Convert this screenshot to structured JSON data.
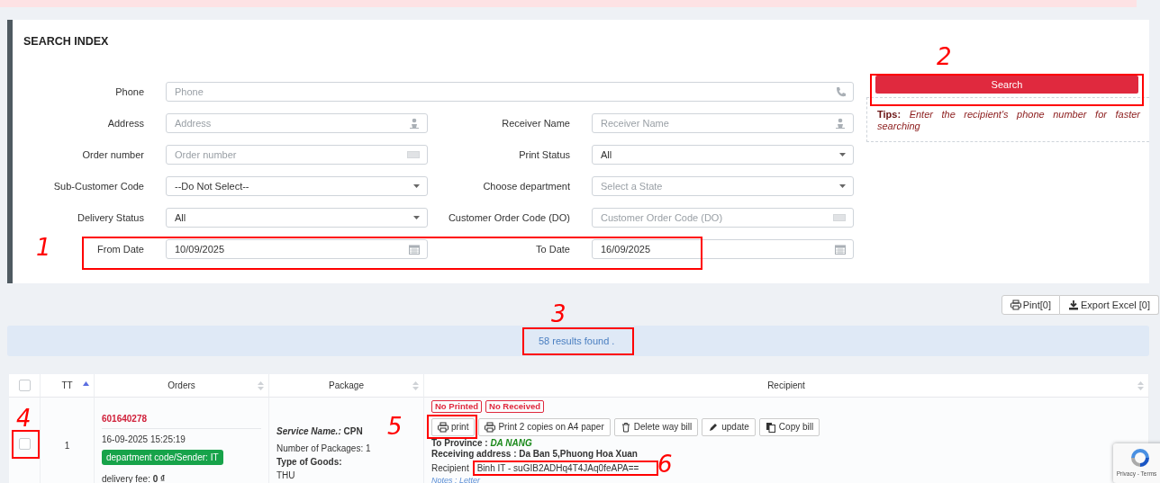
{
  "search_panel": {
    "title": "SEARCH INDEX",
    "rows": [
      [
        {
          "label": "Phone",
          "placeholder": "Phone",
          "kind": "phone"
        }
      ],
      [
        {
          "label": "Address",
          "placeholder": "Address",
          "kind": "person"
        },
        {
          "label": "Receiver Name",
          "placeholder": "Receiver Name",
          "kind": "person"
        }
      ],
      [
        {
          "label": "Order number",
          "placeholder": "Order number",
          "kind": "barcode"
        },
        {
          "label": "Print Status",
          "value": "All",
          "kind": "select"
        }
      ],
      [
        {
          "label": "Sub-Customer Code",
          "value": "--Do Not Select--",
          "kind": "select"
        },
        {
          "label": "Choose department",
          "placeholder": "Select a State",
          "kind": "select"
        }
      ],
      [
        {
          "label": "Delivery Status",
          "value": "All",
          "kind": "select"
        },
        {
          "label": "Customer Order Code (DO)",
          "placeholder": "Customer Order Code (DO)",
          "kind": "barcode"
        }
      ],
      [
        {
          "label": "From Date",
          "value": "10/09/2025",
          "kind": "date"
        },
        {
          "label": "To Date",
          "value": "16/09/2025",
          "kind": "date"
        }
      ]
    ],
    "search_button": "Search",
    "tips": {
      "label": "Tips:",
      "text": "Enter the recipient's phone number for faster searching"
    }
  },
  "toolbar": [
    {
      "label": "Pint[0]",
      "kind": "print"
    },
    {
      "label": "Export Excel [0]",
      "kind": "download"
    }
  ],
  "results": "58 results found .",
  "table": {
    "select_all": {
      "checked": false
    },
    "columns": [
      {
        "label": "TT",
        "sorted": true
      },
      {
        "label": "Orders",
        "sorted": false
      },
      {
        "label": "Package",
        "sorted": false
      },
      {
        "label": "Recipient",
        "sorted": false
      }
    ],
    "rows": [
      {
        "checked": false,
        "tt": "1",
        "order": {
          "number": "601640278",
          "time": "16-09-2025 15:25:19",
          "department": "department code/Sender: IT",
          "fee_label": "delivery fee:",
          "fee": "0 ₫"
        },
        "package": {
          "service_label": "Service Name.:",
          "service": "CPN",
          "count": "Number of Packages: 1",
          "goods_label": "Type of Goods:",
          "goods": "THU"
        },
        "recipient": {
          "badges": [
            "No Printed",
            "No Received"
          ],
          "actions": [
            {
              "label": "print",
              "kind": "print"
            },
            {
              "label": "Print 2 copies on A4 paper",
              "kind": "print"
            },
            {
              "label": "Delete way bill",
              "kind": "trash"
            },
            {
              "label": "update",
              "kind": "pencil"
            },
            {
              "label": "Copy bill",
              "kind": "copy"
            }
          ],
          "province_label": "To Province :",
          "province": "DA NANG",
          "address": "Receiving address : Da Ban 5,Phuong Hoa Xuan",
          "name_label": "Recipient",
          "name": "Binh IT - suGIB2ADHq4T4JAq0feAPA==",
          "notes": "Notes : Letter"
        }
      }
    ]
  },
  "recaptcha": {
    "text": "Privacy - Terms"
  },
  "annotations": [
    {
      "label": "1"
    },
    {
      "label": "2"
    },
    {
      "label": "3"
    },
    {
      "label": "4"
    },
    {
      "label": "5"
    },
    {
      "label": "6"
    }
  ]
}
